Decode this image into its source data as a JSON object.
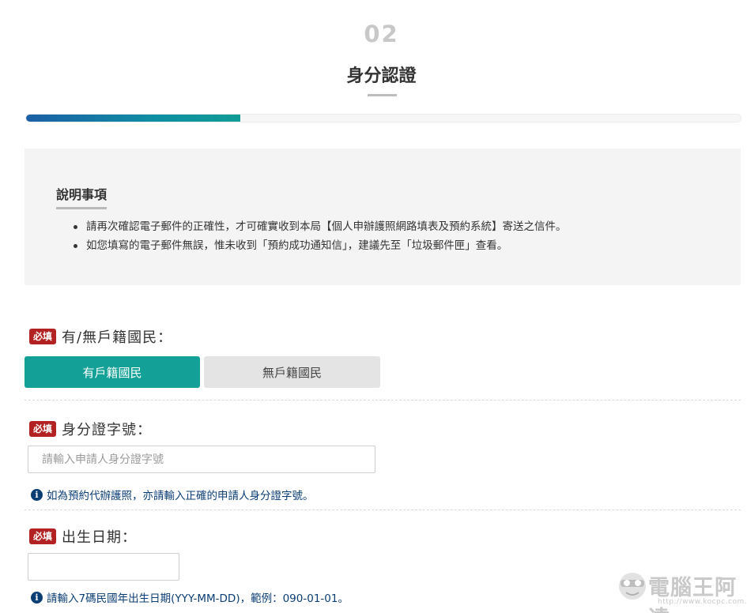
{
  "step": {
    "number": "02",
    "title": "身分認證",
    "progress_percent": 30
  },
  "notice": {
    "heading": "說明事項",
    "items": [
      "請再次確認電子郵件的正確性，才可確實收到本局【個人申辦護照網路填表及預約系統】寄送之信件。",
      "如您填寫的電子郵件無誤，惟未收到「預約成功通知信」，建議先至「垃圾郵件匣」查看。"
    ]
  },
  "form": {
    "required_badge": "必填",
    "household": {
      "label": "有/無戶籍國民：",
      "options": [
        "有戶籍國民",
        "無戶籍國民"
      ],
      "selected": "有戶籍國民"
    },
    "id_number": {
      "label": "身分證字號：",
      "placeholder": "請輸入申請人身分證字號",
      "value": "",
      "hint": "如為預約代辦護照，亦請輸入正確的申請人身分證字號。"
    },
    "birth_date": {
      "label": "出生日期：",
      "placeholder": "",
      "value": "",
      "hint": "請輸入7碼民國年出生日期(YYY-MM-DD)，範例：090-01-01。"
    }
  },
  "icons": {
    "info": "info-circle-icon"
  },
  "colors": {
    "accent_teal": "#13a096",
    "required_red": "#b22222",
    "hint_blue": "#0b3d75",
    "progress_start": "#1b5fa6"
  },
  "watermark": {
    "text": "電腦王阿達",
    "url": "http://www.kocpc.com.tw"
  }
}
